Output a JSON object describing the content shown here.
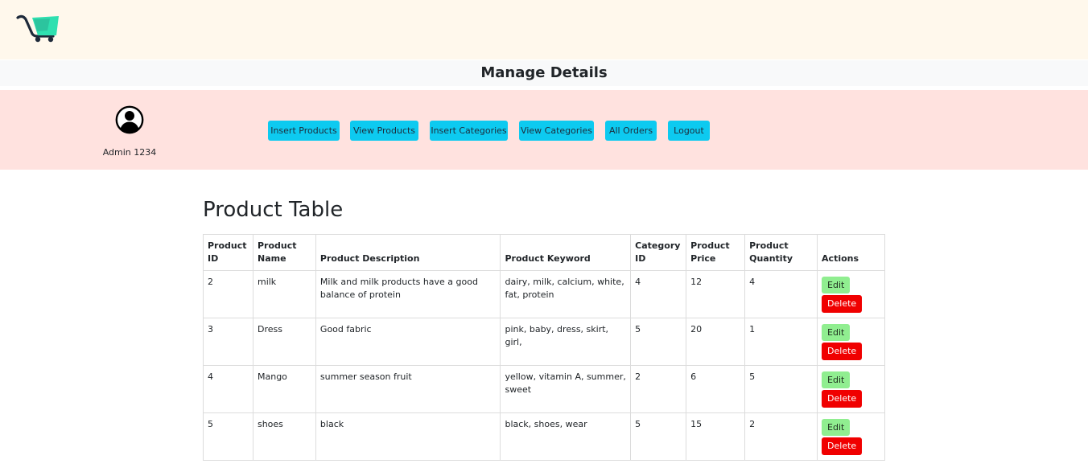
{
  "header": {
    "logo_icon": "shopping-cart-icon",
    "page_title": "Manage Details"
  },
  "admin": {
    "avatar_icon": "user-circle-icon",
    "name": "Admin 1234"
  },
  "nav": {
    "insert_products": "Insert Products",
    "view_products": "View Products",
    "insert_categories": "Insert Categories",
    "view_categories": "View Categories",
    "all_orders": "All Orders",
    "logout": "Logout"
  },
  "colors": {
    "topbar_bg": "#fff8ec",
    "navband_bg": "#ffe2df",
    "nav_button": "#0dcaf0",
    "edit_button": "#90ee90",
    "delete_button": "#f00000"
  },
  "product_table": {
    "title": "Product Table",
    "columns": {
      "id": "Product ID",
      "name": "Product Name",
      "description": "Product Description",
      "keyword": "Product Keyword",
      "category": "Category ID",
      "price": "Product Price",
      "quantity": "Product Quantity",
      "actions": "Actions"
    },
    "edit_label": "Edit",
    "delete_label": "Delete",
    "rows": [
      {
        "id": "2",
        "name": "milk",
        "description": "Milk and milk products have a good balance of protein",
        "keyword": "dairy, milk, calcium, white, fat, protein",
        "category": "4",
        "price": "12",
        "quantity": "4"
      },
      {
        "id": "3",
        "name": "Dress",
        "description": "Good fabric",
        "keyword": "pink, baby, dress, skirt, girl,",
        "category": "5",
        "price": "20",
        "quantity": "1"
      },
      {
        "id": "4",
        "name": "Mango",
        "description": "summer season fruit",
        "keyword": "yellow, vitamin A, summer, sweet",
        "category": "2",
        "price": "6",
        "quantity": "5"
      },
      {
        "id": "5",
        "name": "shoes",
        "description": "black",
        "keyword": "black, shoes, wear",
        "category": "5",
        "price": "15",
        "quantity": "2"
      }
    ]
  }
}
